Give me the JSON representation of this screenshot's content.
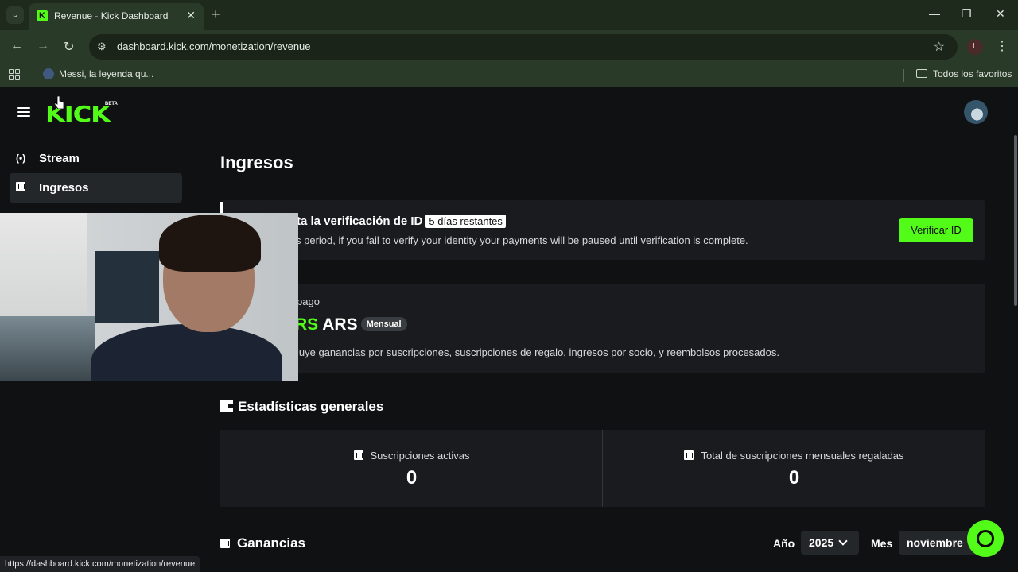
{
  "browser": {
    "tab_title": "Revenue - Kick Dashboard",
    "url": "dashboard.kick.com/monetization/revenue",
    "bookmark": "Messi, la leyenda qu...",
    "all_bookmarks": "Todos los favoritos",
    "profile_initial": "L",
    "status_url": "https://dashboard.kick.com/monetization/revenue"
  },
  "brand": {
    "logo": "KICK",
    "beta": "BETA",
    "accent": "#53fc18"
  },
  "sidebar": {
    "items": [
      {
        "label": "Stream",
        "icon": "broadcast-icon"
      },
      {
        "label": "Ingresos",
        "icon": "chart-icon"
      }
    ]
  },
  "main": {
    "title": "Ingresos",
    "verification": {
      "title": "ta la verificación de ID",
      "badge": "5 días restantes",
      "description": "s period, if you fail to verify your identity your payments will be paused until verification is complete.",
      "button": "Verificar ID"
    },
    "payment": {
      "label": "pago",
      "amount_prefix": "RS",
      "currency": "ARS",
      "badge": "Mensual",
      "description": "luye ganancias por suscripciones, suscripciones de regalo, ingresos por socio, y reembolsos procesados."
    },
    "stats": {
      "title": "Estadísticas generales",
      "items": [
        {
          "label": "Suscripciones activas",
          "value": "0"
        },
        {
          "label": "Total de suscripciones mensuales regaladas",
          "value": "0"
        }
      ]
    },
    "earnings": {
      "title": "Ganancias",
      "year_label": "Año",
      "year_value": "2025",
      "month_label": "Mes",
      "month_value": "noviembre"
    }
  }
}
